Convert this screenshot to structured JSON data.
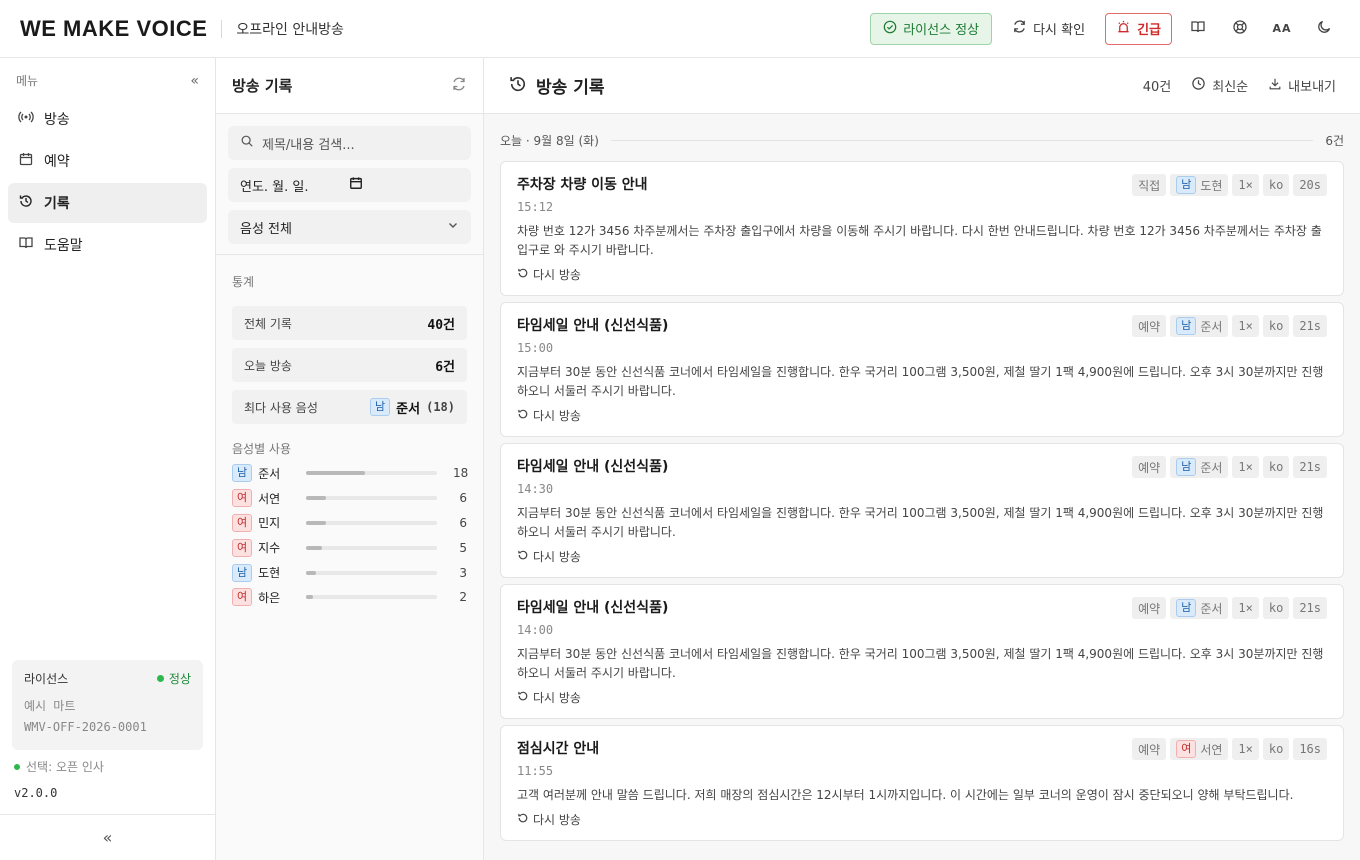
{
  "header": {
    "brand": "WE MAKE VOICE",
    "subtitle": "오프라인 안내방송",
    "license_status": "라이선스 정상",
    "recheck": "다시 확인",
    "urgent": "긴급",
    "font_size_label": "AA"
  },
  "sidebar": {
    "menu_label": "메뉴",
    "items": [
      {
        "label": "방송",
        "icon": "broadcast-icon"
      },
      {
        "label": "예약",
        "icon": "calendar-icon"
      },
      {
        "label": "기록",
        "icon": "history-icon",
        "active": true
      },
      {
        "label": "도움말",
        "icon": "book-icon"
      }
    ],
    "license": {
      "label": "라이선스",
      "status": "정상",
      "store": "예시 마트",
      "key": "WMV-OFF-2026-0001"
    },
    "selected": "선택: 오픈 인사",
    "version": "v2.0.0"
  },
  "history_panel": {
    "title": "방송 기록",
    "search_placeholder": "제목/내용 검색...",
    "date_placeholder": "연도. 월. 일.",
    "voice_filter": "음성 전체",
    "stats_label": "통계",
    "stats": [
      {
        "label": "전체 기록",
        "value": "40건"
      },
      {
        "label": "오늘 방송",
        "value": "6건"
      },
      {
        "label": "최다 사용 음성",
        "gender": "남",
        "voice": "준서",
        "count": "(18)"
      }
    ],
    "voice_usage_label": "음성별 사용",
    "voice_usage": [
      {
        "gender": "남",
        "gender_type": "m",
        "name": "준서",
        "count": 18
      },
      {
        "gender": "여",
        "gender_type": "f",
        "name": "서연",
        "count": 6
      },
      {
        "gender": "여",
        "gender_type": "f",
        "name": "민지",
        "count": 6
      },
      {
        "gender": "여",
        "gender_type": "f",
        "name": "지수",
        "count": 5
      },
      {
        "gender": "남",
        "gender_type": "m",
        "name": "도현",
        "count": 3
      },
      {
        "gender": "여",
        "gender_type": "f",
        "name": "하은",
        "count": 2
      }
    ],
    "voice_usage_max": 40
  },
  "main": {
    "title": "방송 기록",
    "count": "40건",
    "sort": "최신순",
    "export": "내보내기",
    "day_label": "오늘 · 9월 8일 (화)",
    "day_count": "6건",
    "replay_label": "다시 방송",
    "records": [
      {
        "title": "주차장 차량 이동 안내",
        "time": "15:12",
        "type": "직접",
        "gender": "남",
        "gender_type": "m",
        "voice": "도현",
        "speed": "1×",
        "lang": "ko",
        "duration": "20s",
        "text": "차량 번호 12가 3456 차주분께서는 주차장 출입구에서 차량을 이동해 주시기 바랍니다. 다시 한번 안내드립니다. 차량 번호 12가 3456 차주분께서는 주차장 출입구로 와 주시기 바랍니다."
      },
      {
        "title": "타임세일 안내 (신선식품)",
        "time": "15:00",
        "type": "예약",
        "gender": "남",
        "gender_type": "m",
        "voice": "준서",
        "speed": "1×",
        "lang": "ko",
        "duration": "21s",
        "text": "지금부터 30분 동안 신선식품 코너에서 타임세일을 진행합니다. 한우 국거리 100그램 3,500원, 제철 딸기 1팩 4,900원에 드립니다. 오후 3시 30분까지만 진행하오니 서둘러 주시기 바랍니다."
      },
      {
        "title": "타임세일 안내 (신선식품)",
        "time": "14:30",
        "type": "예약",
        "gender": "남",
        "gender_type": "m",
        "voice": "준서",
        "speed": "1×",
        "lang": "ko",
        "duration": "21s",
        "text": "지금부터 30분 동안 신선식품 코너에서 타임세일을 진행합니다. 한우 국거리 100그램 3,500원, 제철 딸기 1팩 4,900원에 드립니다. 오후 3시 30분까지만 진행하오니 서둘러 주시기 바랍니다."
      },
      {
        "title": "타임세일 안내 (신선식품)",
        "time": "14:00",
        "type": "예약",
        "gender": "남",
        "gender_type": "m",
        "voice": "준서",
        "speed": "1×",
        "lang": "ko",
        "duration": "21s",
        "text": "지금부터 30분 동안 신선식품 코너에서 타임세일을 진행합니다. 한우 국거리 100그램 3,500원, 제철 딸기 1팩 4,900원에 드립니다. 오후 3시 30분까지만 진행하오니 서둘러 주시기 바랍니다."
      },
      {
        "title": "점심시간 안내",
        "time": "11:55",
        "type": "예약",
        "gender": "여",
        "gender_type": "f",
        "voice": "서연",
        "speed": "1×",
        "lang": "ko",
        "duration": "16s",
        "text": "고객 여러분께 안내 말씀 드립니다. 저희 매장의 점심시간은 12시부터 1시까지입니다. 이 시간에는 일부 코너의 운영이 잠시 중단되오니 양해 부탁드립니다."
      }
    ]
  }
}
